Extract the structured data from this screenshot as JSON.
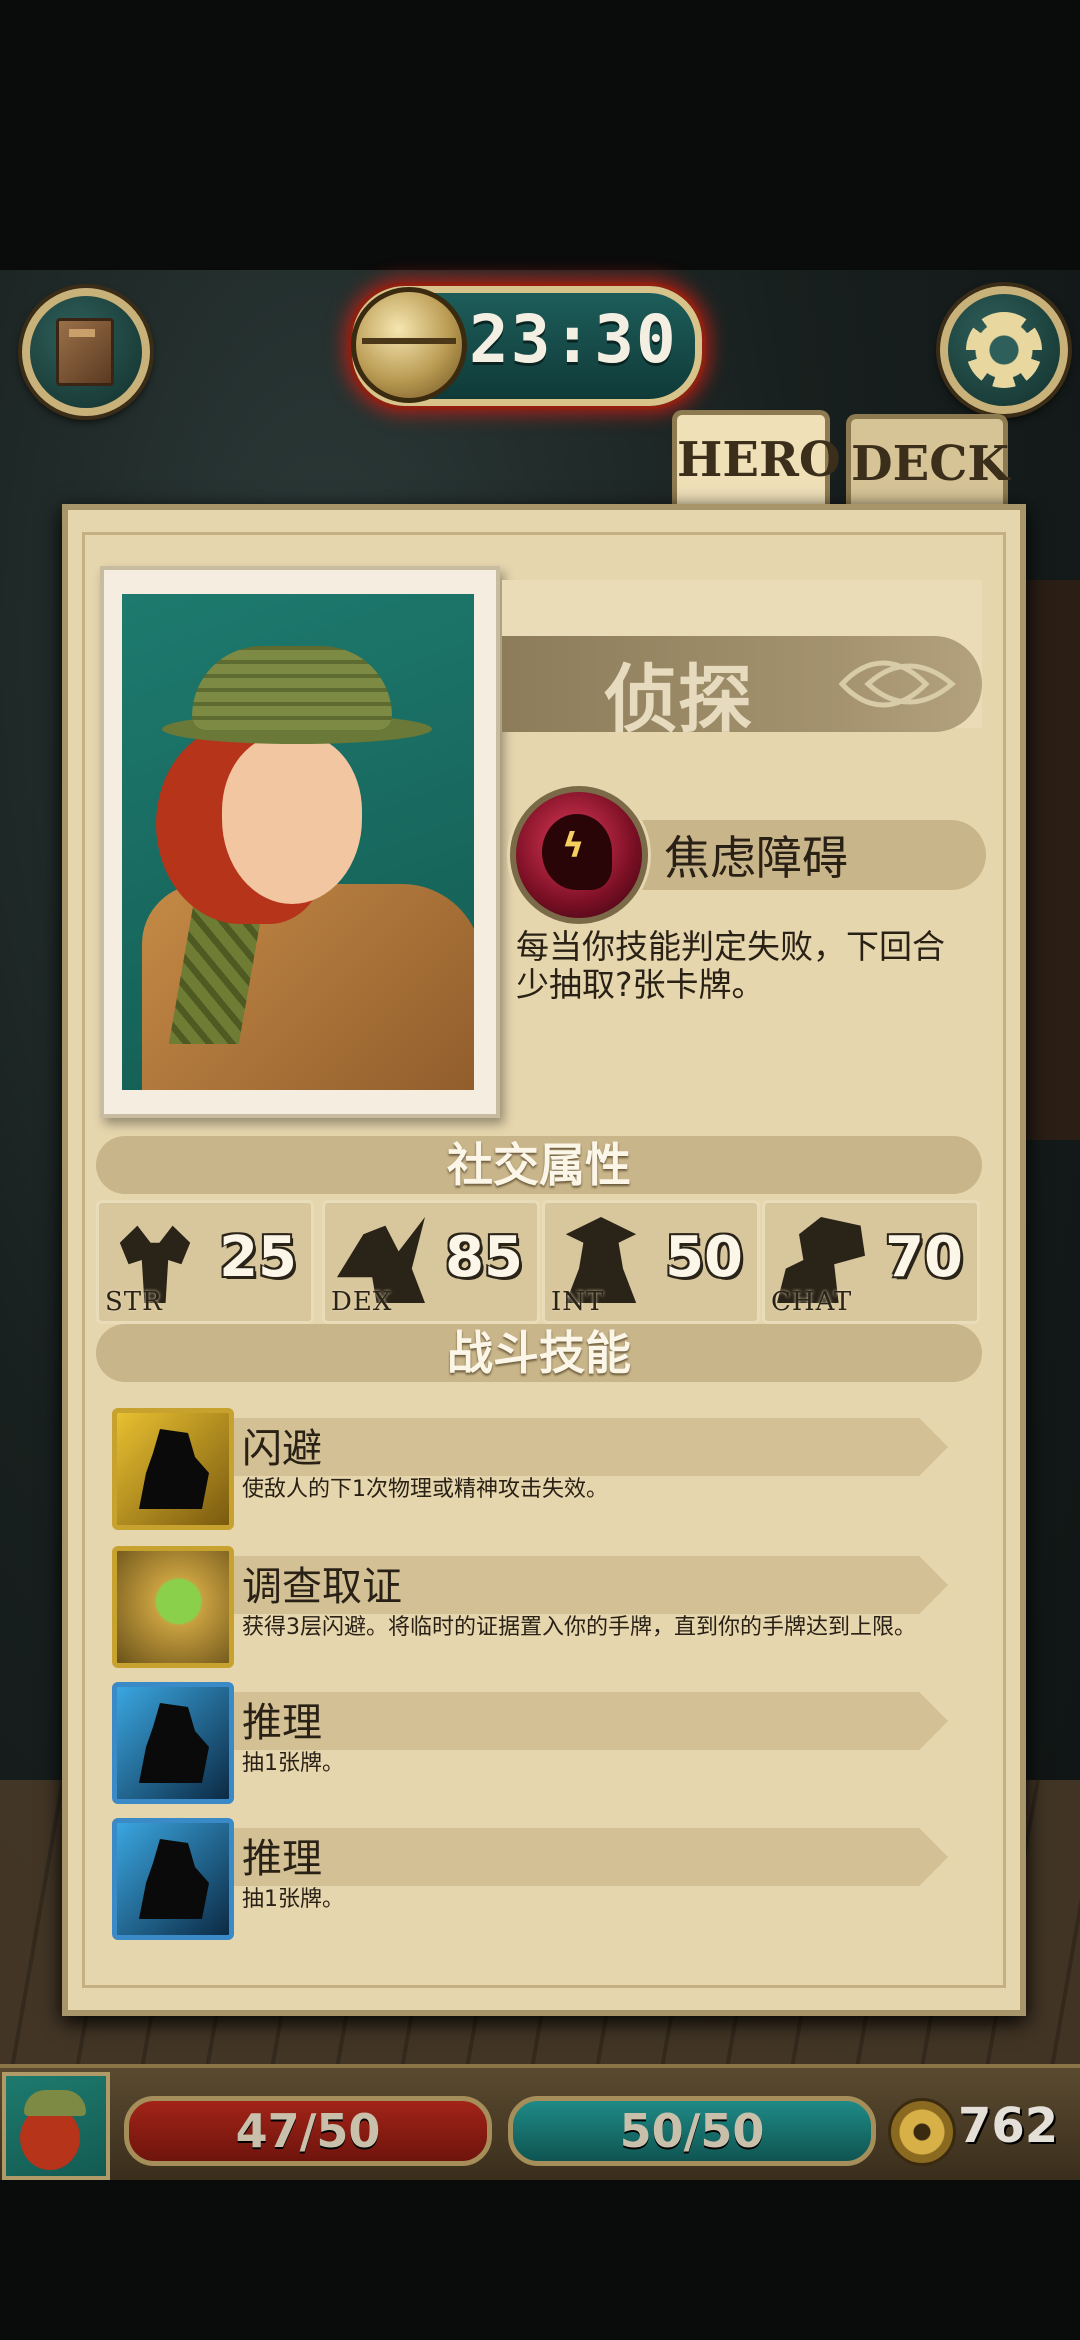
{
  "header": {
    "timer": "23:30"
  },
  "tabs": [
    {
      "label": "HERO",
      "active": true
    },
    {
      "label": "DECK",
      "active": false
    }
  ],
  "hero": {
    "class_name": "侦探",
    "trait": {
      "name": "焦虑障碍",
      "description": "每当你技能判定失败，下回合少抽取?张卡牌。"
    }
  },
  "social": {
    "title": "社交属性",
    "stats": [
      {
        "abbr": "STR",
        "value": "25"
      },
      {
        "abbr": "DEX",
        "value": "85"
      },
      {
        "abbr": "INT",
        "value": "50"
      },
      {
        "abbr": "CHAT",
        "value": "70"
      }
    ]
  },
  "combat": {
    "title": "战斗技能",
    "skills": [
      {
        "name": "闪避",
        "description": "使敌人的下1次物理或精神攻击失效。",
        "icon": "dodge-icon"
      },
      {
        "name": "调查取证",
        "description": "获得3层闪避。将临时的证据置入你的手牌，直到你的手牌达到上限。",
        "icon": "magnifier-icon"
      },
      {
        "name": "推理",
        "description": "抽1张牌。",
        "icon": "deduction-icon"
      },
      {
        "name": "推理",
        "description": "抽1张牌。",
        "icon": "deduction-icon"
      }
    ]
  },
  "hud": {
    "hp": "47/50",
    "sp": "50/50",
    "coins": "762"
  },
  "colors": {
    "parchment": "#e6d6ae",
    "hp_red": "#a22418",
    "sp_teal": "#1f8a86",
    "timer_glow": "#c81e14"
  }
}
